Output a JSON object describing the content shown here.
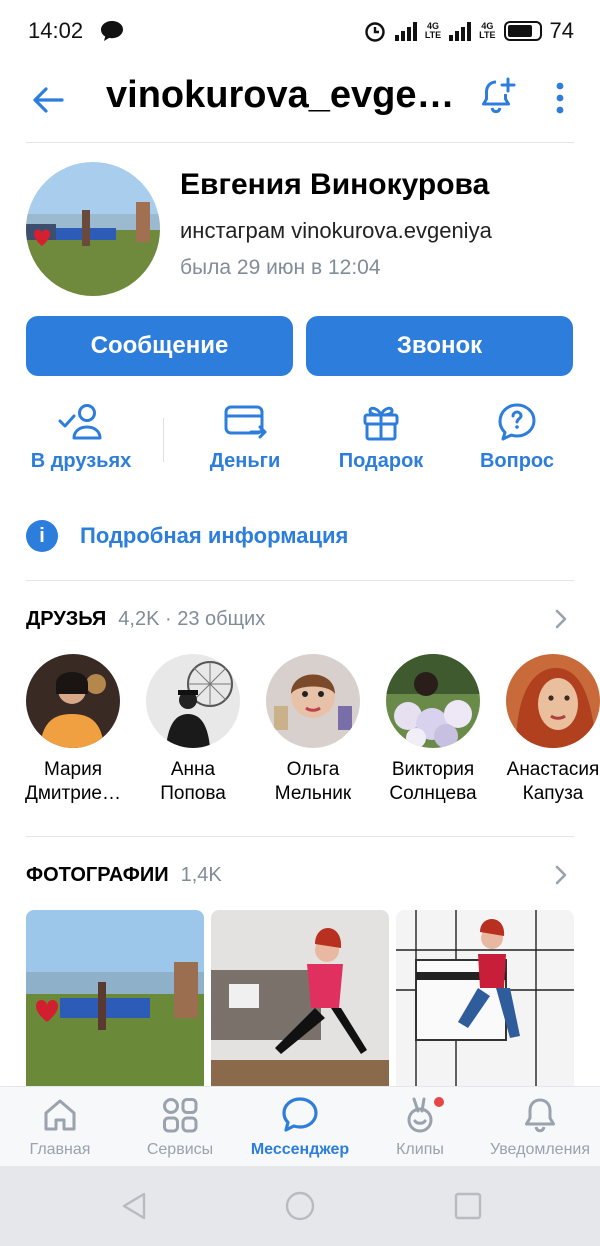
{
  "status_bar": {
    "time": "14:02",
    "battery": "74",
    "network1": "4G",
    "network2": "4G"
  },
  "header": {
    "title": "vinokurova_evgeniya"
  },
  "profile": {
    "name": "Евгения Винокурова",
    "status": "инстаграм vinokurova.evgeniya",
    "last_seen": "была 29 июн в 12:04"
  },
  "buttons": {
    "message": "Сообщение",
    "call": "Звонок"
  },
  "actions": [
    {
      "label": "В друзьях",
      "icon": "user-check-icon"
    },
    {
      "label": "Деньги",
      "icon": "money-transfer-icon"
    },
    {
      "label": "Подарок",
      "icon": "gift-icon"
    },
    {
      "label": "Вопрос",
      "icon": "question-icon"
    }
  ],
  "info_link": "Подробная информация",
  "friends_section": {
    "title": "ДРУЗЬЯ",
    "count": "4,2K · 23 общих"
  },
  "friends": [
    {
      "first": "Мария",
      "last": "Дмитрие…"
    },
    {
      "first": "Анна",
      "last": "Попова"
    },
    {
      "first": "Ольга",
      "last": "Мельник"
    },
    {
      "first": "Виктория",
      "last": "Солнцева"
    },
    {
      "first": "Анастасия",
      "last": "Капуза"
    }
  ],
  "photos_section": {
    "title": "ФОТОГРАФИИ",
    "count": "1,4K"
  },
  "tabs": [
    {
      "label": "Главная",
      "icon": "home-icon"
    },
    {
      "label": "Сервисы",
      "icon": "grid-icon"
    },
    {
      "label": "Мессенджер",
      "icon": "chat-icon",
      "active": true
    },
    {
      "label": "Клипы",
      "icon": "clips-icon"
    },
    {
      "label": "Уведомления",
      "icon": "bell-icon"
    }
  ],
  "colors": {
    "accent": "#2c7ddc",
    "muted": "#818c99",
    "badge": "#e64646"
  }
}
